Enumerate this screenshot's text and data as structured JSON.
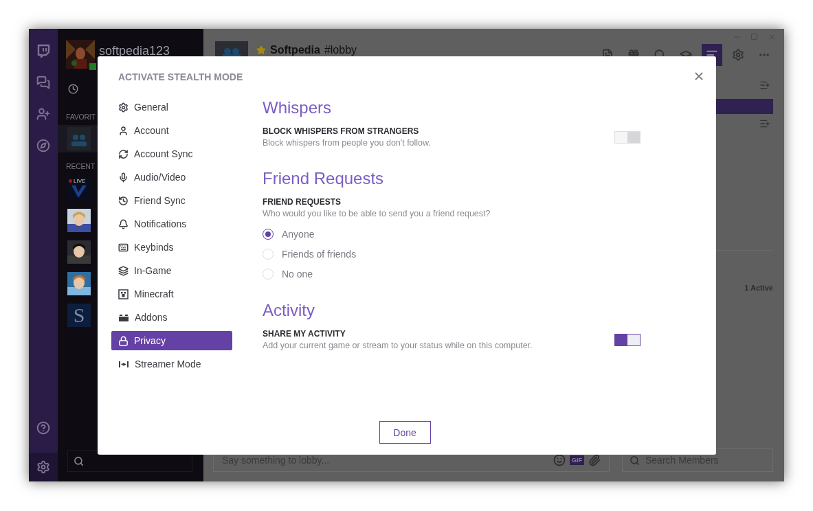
{
  "app": {
    "user": {
      "name": "softpedia123",
      "online": true
    },
    "favorites_label": "FAVORIT",
    "recent_label": "RECENT",
    "recent": [
      {
        "kind": "live",
        "badge": "LIVE"
      },
      {
        "kind": "picture"
      },
      {
        "kind": "picture"
      },
      {
        "kind": "picture"
      },
      {
        "kind": "letter",
        "letter": "S"
      }
    ],
    "channel": {
      "starred": true,
      "group": "Softpedia",
      "name": "#lobby"
    },
    "toolbar": [
      {
        "kind": "file",
        "selected": false
      },
      {
        "kind": "gift",
        "selected": false
      },
      {
        "kind": "search",
        "selected": false
      },
      {
        "kind": "cap",
        "selected": false
      },
      {
        "kind": "list",
        "selected": true
      },
      {
        "kind": "gear",
        "selected": false
      },
      {
        "kind": "dots",
        "selected": false
      }
    ],
    "active_count": "1 Active",
    "chat_placeholder": "Say something to lobby...",
    "gif": "GIF",
    "member_search_placeholder": "Search Members"
  },
  "dialog": {
    "title": "ACTIVATE STEALTH MODE",
    "nav": [
      {
        "kind": "gear",
        "label": "General",
        "selected": false
      },
      {
        "kind": "user",
        "label": "Account",
        "selected": false
      },
      {
        "kind": "sync",
        "label": "Account Sync",
        "selected": false
      },
      {
        "kind": "mic",
        "label": "Audio/Video",
        "selected": false
      },
      {
        "kind": "history",
        "label": "Friend Sync",
        "selected": false
      },
      {
        "kind": "bell",
        "label": "Notifications",
        "selected": false
      },
      {
        "kind": "keyboard",
        "label": "Keybinds",
        "selected": false
      },
      {
        "kind": "layers",
        "label": "In-Game",
        "selected": false
      },
      {
        "kind": "block",
        "label": "Minecraft",
        "selected": false
      },
      {
        "kind": "addons",
        "label": "Addons",
        "selected": false
      },
      {
        "kind": "lock",
        "label": "Privacy",
        "selected": true
      },
      {
        "kind": "stream",
        "label": "Streamer Mode",
        "selected": false
      }
    ],
    "sections": [
      {
        "heading": "Whispers",
        "settings": [
          {
            "kind": "toggle",
            "label": "BLOCK WHISPERS FROM STRANGERS",
            "description": "Block whispers from people you don't follow.",
            "on": false
          }
        ]
      },
      {
        "heading": "Friend Requests",
        "settings": [
          {
            "kind": "radio",
            "label": "FRIEND REQUESTS",
            "description": "Who would you like to be able to send you a friend request?",
            "options": [
              {
                "label": "Anyone",
                "selected": true
              },
              {
                "label": "Friends of friends",
                "selected": false
              },
              {
                "label": "No one",
                "selected": false
              }
            ]
          }
        ]
      },
      {
        "heading": "Activity",
        "settings": [
          {
            "kind": "toggle",
            "label": "SHARE MY ACTIVITY",
            "description": "Add your current game or stream to your status while on this computer.",
            "on": true
          }
        ]
      }
    ],
    "done": "Done"
  }
}
